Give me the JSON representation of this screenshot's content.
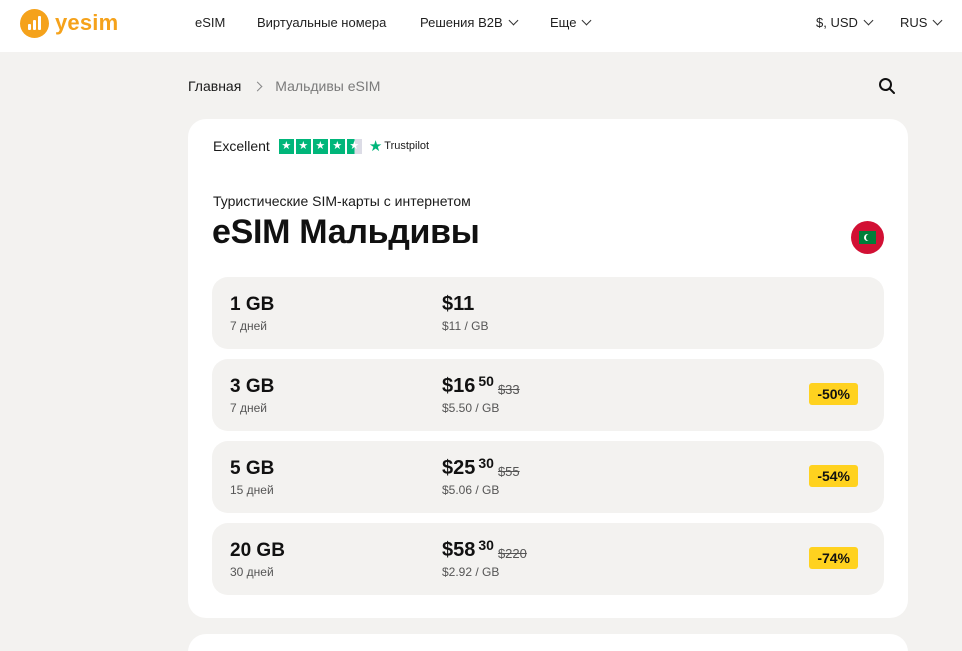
{
  "brand": {
    "name": "yesim",
    "color": "#f5a21b"
  },
  "nav": {
    "esim": "eSIM",
    "virtual_numbers": "Виртуальные номера",
    "b2b": "Решения B2B",
    "more": "Еще",
    "currency": "$, USD",
    "language": "RUS"
  },
  "breadcrumb": {
    "home": "Главная",
    "current": "Мальдивы eSIM"
  },
  "trustpilot": {
    "rating_label": "Excellent",
    "brand": "Trustpilot",
    "stars": 4.5
  },
  "page": {
    "subtitle": "Туристические SIM-карты с интернетом",
    "title": "eSIM Мальдивы"
  },
  "plans": [
    {
      "data": "1 GB",
      "days": "7 дней",
      "price": "$11",
      "cents": "",
      "old_price": "",
      "per_gb": "$11 / GB",
      "discount": ""
    },
    {
      "data": "3 GB",
      "days": "7 дней",
      "price": "$16",
      "cents": "50",
      "old_price": "$33",
      "per_gb": "$5.50 / GB",
      "discount": "-50%"
    },
    {
      "data": "5 GB",
      "days": "15 дней",
      "price": "$25",
      "cents": "30",
      "old_price": "$55",
      "per_gb": "$5.06 / GB",
      "discount": "-54%"
    },
    {
      "data": "20 GB",
      "days": "30 дней",
      "price": "$58",
      "cents": "30",
      "old_price": "$220",
      "per_gb": "$2.92 / GB",
      "discount": "-74%"
    }
  ],
  "colors": {
    "background": "#f3f2f0",
    "trustpilot_green": "#00b67a",
    "discount_yellow": "#ffd21f"
  },
  "icons": {
    "search": "search-icon",
    "flag": "maldives-flag-icon"
  }
}
